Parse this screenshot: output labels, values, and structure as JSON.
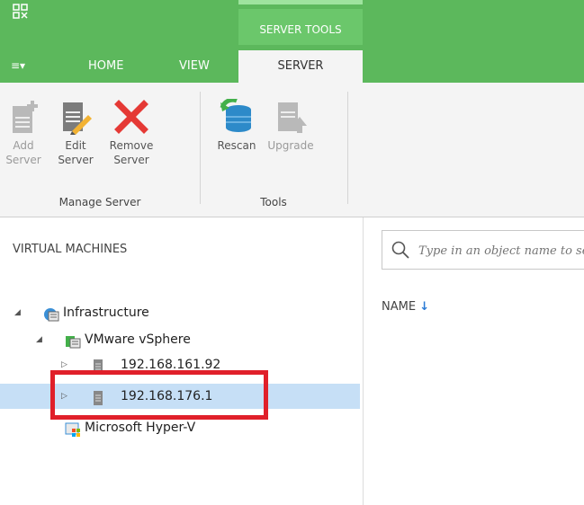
{
  "app": {
    "icon": "veeam-logo-icon"
  },
  "ribbon": {
    "context_group": "SERVER TOOLS",
    "tabs": [
      {
        "label": "HOME"
      },
      {
        "label": "VIEW"
      },
      {
        "label": "SERVER"
      }
    ],
    "menu_icon": "≡▾",
    "groups": [
      {
        "label": "Manage Server",
        "buttons": [
          {
            "label": "Add Server",
            "line1": "Add",
            "line2": "Server",
            "icon": "add-server-icon",
            "disabled": true
          },
          {
            "label": "Edit Server",
            "line1": "Edit",
            "line2": "Server",
            "icon": "edit-server-icon",
            "disabled": false
          },
          {
            "label": "Remove Server",
            "line1": "Remove",
            "line2": "Server",
            "icon": "remove-server-icon",
            "disabled": false
          }
        ]
      },
      {
        "label": "Tools",
        "buttons": [
          {
            "label": "Rescan",
            "line1": "Rescan",
            "line2": "",
            "icon": "rescan-icon",
            "disabled": false
          },
          {
            "label": "Upgrade",
            "line1": "Upgrade",
            "line2": "",
            "icon": "upgrade-icon",
            "disabled": true
          }
        ]
      }
    ]
  },
  "left_pane": {
    "header": "VIRTUAL MACHINES",
    "tree": [
      {
        "label": "Infrastructure",
        "icon": "infrastructure-icon"
      },
      {
        "label": "VMware vSphere",
        "icon": "vsphere-icon"
      },
      {
        "label": "192.168.161.92",
        "icon": "host-icon"
      },
      {
        "label": "192.168.176.1",
        "icon": "host-icon",
        "selected": true
      },
      {
        "label": "Microsoft Hyper-V",
        "icon": "hyperv-icon"
      }
    ]
  },
  "main": {
    "search_placeholder": "Type in an object name to search for",
    "column_header": "NAME",
    "sort_indicator": "↓"
  },
  "colors": {
    "brand_green": "#5cb85c",
    "selection_blue": "#c6dff6",
    "highlight_red": "#e0202a",
    "remove_red": "#e53935"
  }
}
